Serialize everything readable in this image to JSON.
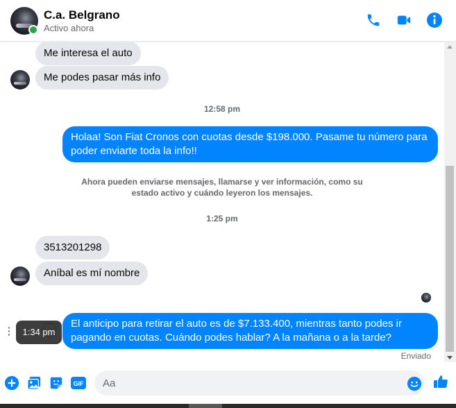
{
  "header": {
    "contact_name": "C.a. Belgrano",
    "status": "Activo ahora",
    "icons": [
      "phone-icon",
      "video-camera-icon",
      "info-icon"
    ],
    "accent_color": "#0084ff",
    "online_color": "#31a24c"
  },
  "thread": {
    "in_1": "Me interesa el auto",
    "in_2": "Me podes pasar más info",
    "time_1": "12:58 pm",
    "out_1": "Holaa! Son Fiat Cronos con cuotas desde $198.000. Pasame tu número para poder enviarte toda la info!!",
    "system_note": "Ahora pueden enviarse mensajes, llamarse y ver información, como su estado activo y cuándo leyeron los mensajes.",
    "time_2": "1:25 pm",
    "in_3": "3513201298",
    "in_4": "Aníbal es mí nombre",
    "out_2": "El anticipo para retirar el auto es de $7.133.400, mientras tanto podes ir pagando en cuotas. Cuándo podes hablar? A la mañana o a la tarde?",
    "tooltip": "1:34 pm",
    "sent_status": "Enviado",
    "incoming_bubble_color": "#e4e6eb",
    "outgoing_bubble_color": "#0084ff"
  },
  "composer": {
    "placeholder": "Aa",
    "icons": [
      "plus-circle-icon",
      "photo-icon",
      "sticker-icon",
      "gif-icon",
      "emoji-icon",
      "thumbs-up-icon"
    ],
    "gif_label": "GIF"
  }
}
